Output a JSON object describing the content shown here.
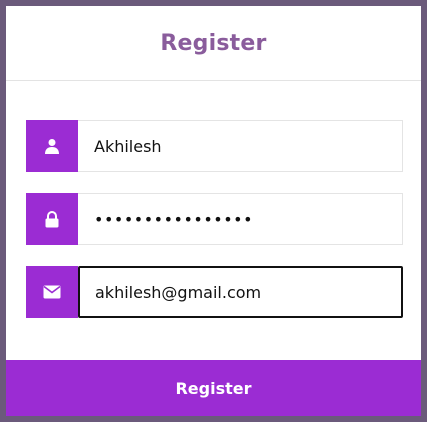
{
  "form": {
    "title": "Register",
    "fields": [
      {
        "icon": "user-icon",
        "value": "Akhilesh"
      },
      {
        "icon": "lock-icon",
        "value": "••••••••••••••••"
      },
      {
        "icon": "envelope-icon",
        "value": "akhilesh@gmail.com"
      }
    ],
    "submit_label": "Register"
  },
  "colors": {
    "accent": "#9b2cd3",
    "title": "#8a5c9c",
    "backdrop": "#6b5a7b"
  }
}
